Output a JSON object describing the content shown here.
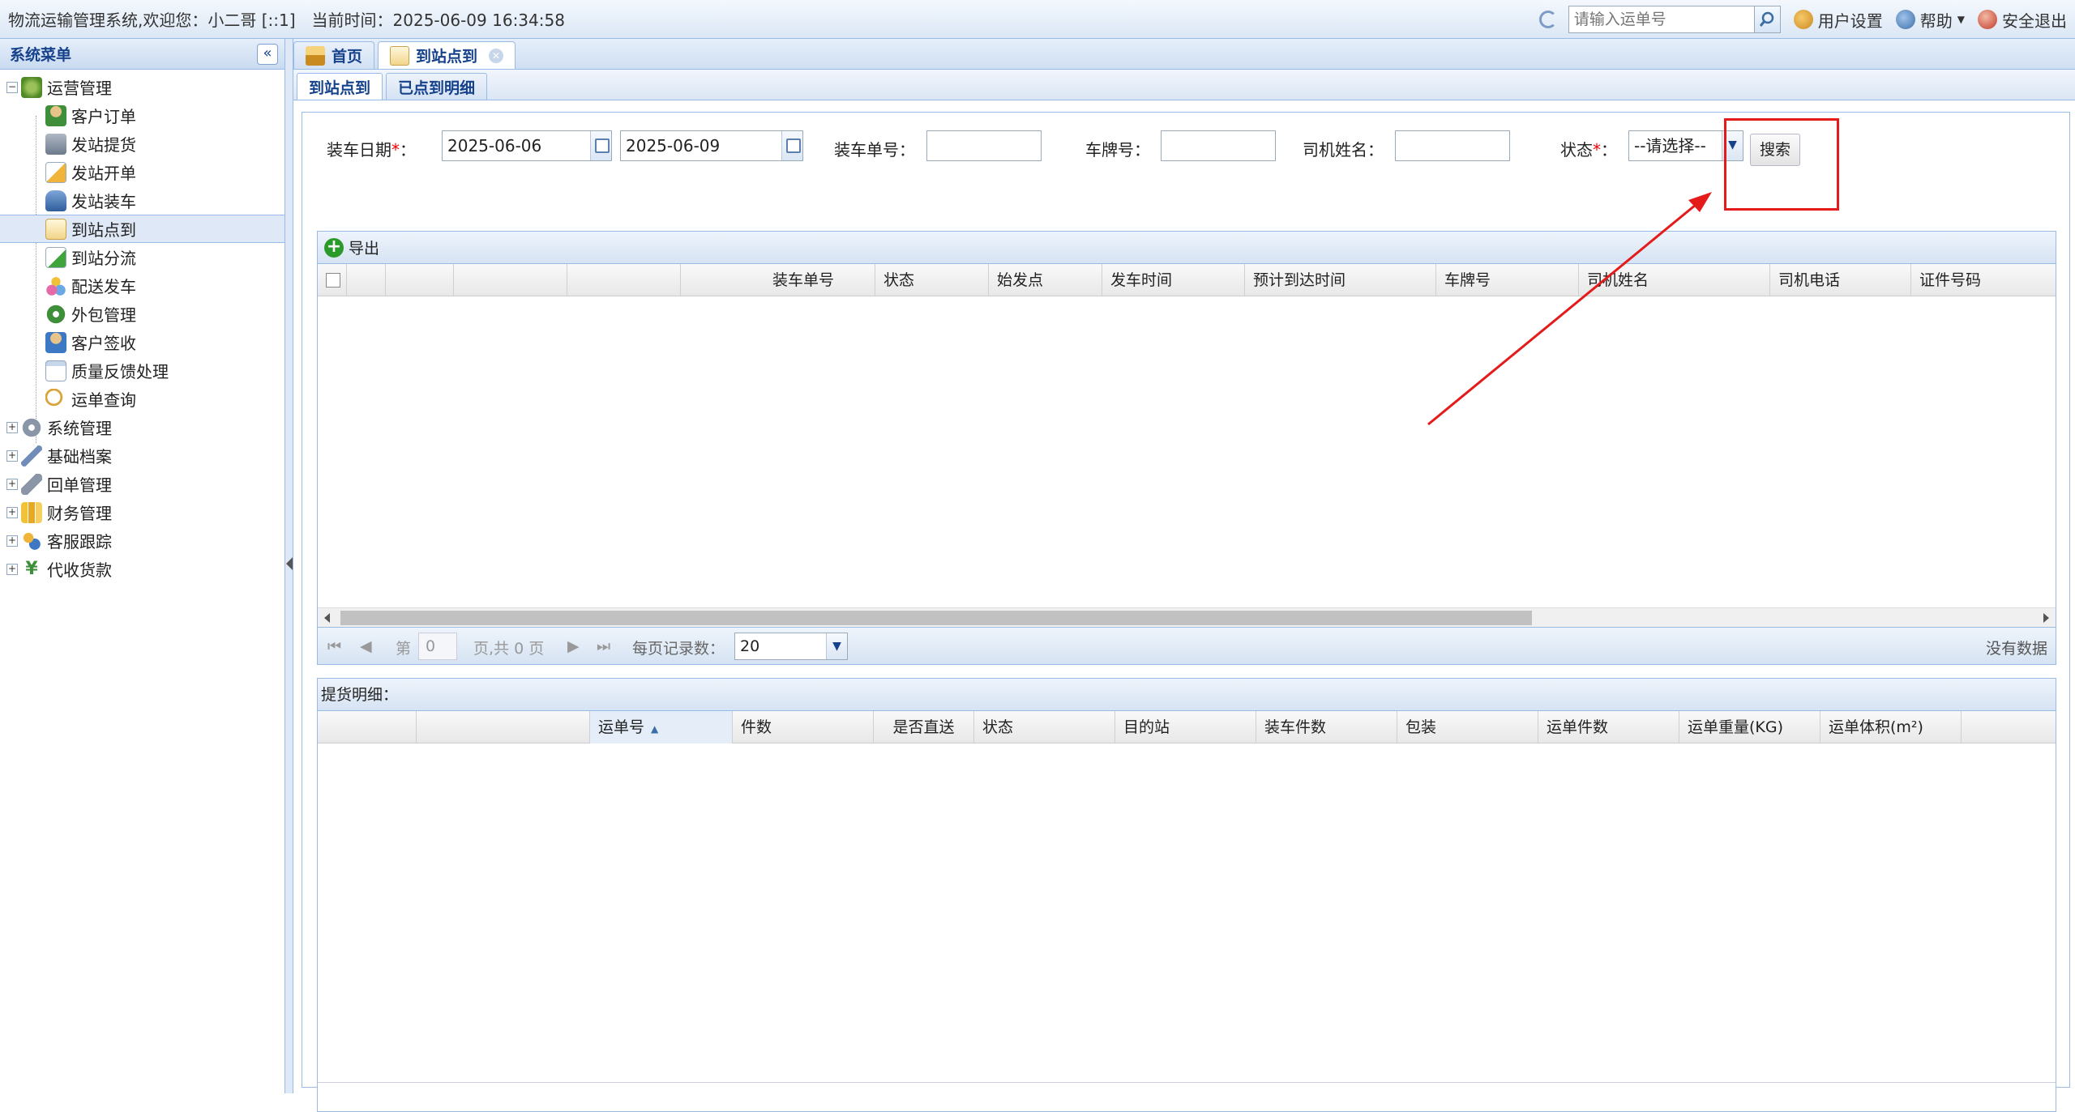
{
  "header": {
    "welcome": "物流运输管理系统,欢迎您：小二哥 [::1]",
    "current_time": "当前时间：2025-06-09 16:34:58",
    "search_placeholder": "请输入运单号",
    "user_settings": "用户设置",
    "help": "帮助",
    "logout": "安全退出"
  },
  "sidebar": {
    "title": "系统菜单",
    "groups": [
      {
        "label": "运营管理",
        "icon": "share-network-icon",
        "expanded": true,
        "children": [
          {
            "label": "客户订单",
            "icon": "user-icon"
          },
          {
            "label": "发站提货",
            "icon": "cart-icon"
          },
          {
            "label": "发站开单",
            "icon": "edit-form-icon"
          },
          {
            "label": "发站装车",
            "icon": "car-icon"
          },
          {
            "label": "到站点到",
            "icon": "checklist-icon",
            "selected": true
          },
          {
            "label": "到站分流",
            "icon": "export-icon"
          },
          {
            "label": "配送发车",
            "icon": "balls-icon"
          },
          {
            "label": "外包管理",
            "icon": "gear-green-icon"
          },
          {
            "label": "客户签收",
            "icon": "users-icon"
          },
          {
            "label": "质量反馈处理",
            "icon": "window-icon"
          },
          {
            "label": "运单查询",
            "icon": "magnifier-icon"
          }
        ]
      },
      {
        "label": "系统管理",
        "icon": "gear-icon"
      },
      {
        "label": "基础档案",
        "icon": "wrench-icon"
      },
      {
        "label": "回单管理",
        "icon": "link-icon"
      },
      {
        "label": "财务管理",
        "icon": "chart-bars-icon"
      },
      {
        "label": "客服跟踪",
        "icon": "group-icon"
      },
      {
        "label": "代收货款",
        "icon": "yen-icon"
      }
    ]
  },
  "tabs": [
    {
      "label": "首页",
      "icon": "home-icon"
    },
    {
      "label": "到站点到",
      "icon": "checklist-icon",
      "active": true
    }
  ],
  "subtabs": [
    {
      "label": "到站点到",
      "active": true
    },
    {
      "label": "已点到明细"
    }
  ],
  "filters": {
    "load_date_label": "装车日期",
    "date_from": "2025-06-06",
    "date_to": "2025-06-09",
    "load_no_label": "装车单号：",
    "plate_label": "车牌号：",
    "driver_label": "司机姓名：",
    "status_label": "状态",
    "status_value": "--请选择--",
    "search_button": "搜索",
    "colon": "：",
    "required_mark": "*"
  },
  "grid1": {
    "toolbar_export": "导出",
    "columns": [
      "装车单号",
      "状态",
      "始发点",
      "发车时间",
      "预计到达时间",
      "车牌号",
      "司机姓名",
      "司机电话",
      "证件号码"
    ],
    "rows": [],
    "pager": {
      "page_prefix": "第",
      "page_value": "0",
      "page_suffix": "页,共 0 页",
      "page_size_label": "每页记录数：",
      "page_size": "20",
      "empty_text": "没有数据"
    }
  },
  "grid2": {
    "title": "提货明细：",
    "columns": [
      "运单号",
      "件数",
      "是否直送",
      "状态",
      "目的站",
      "装车件数",
      "包装",
      "运单件数",
      "运单重量(KG)",
      "运单体积(m²)"
    ],
    "rows": []
  },
  "annotation": {
    "color": "#e41b1b"
  }
}
